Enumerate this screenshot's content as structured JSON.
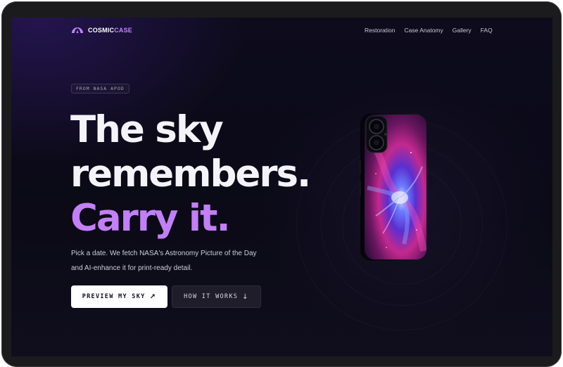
{
  "brand": {
    "name": "COSMIC",
    "accent": "CASE",
    "accent_color": "#c084fc"
  },
  "nav": {
    "links": [
      {
        "label": "Restoration"
      },
      {
        "label": "Case Anatomy"
      },
      {
        "label": "Gallery"
      },
      {
        "label": "FAQ"
      }
    ]
  },
  "hero": {
    "eyebrow": "FROM NASA APOD",
    "headline": {
      "line1": "The sky",
      "line2": "remembers.",
      "line3": "Carry it."
    },
    "subtitle_line1": "Pick a date. We fetch NASA's Astronomy Picture of the Day",
    "subtitle_line2": "and AI-enhance it for print-ready detail.",
    "primary_button": {
      "label": "PREVIEW MY SKY",
      "icon": "arrow-up-right-icon"
    },
    "secondary_button": {
      "label": "HOW IT WORKS",
      "icon": "arrow-down-icon"
    }
  },
  "colors": {
    "background": "#0b0a16",
    "headline": "#f4f3f8",
    "headline_accent": "#c27ff7",
    "primary_button_bg": "#ffffff"
  }
}
